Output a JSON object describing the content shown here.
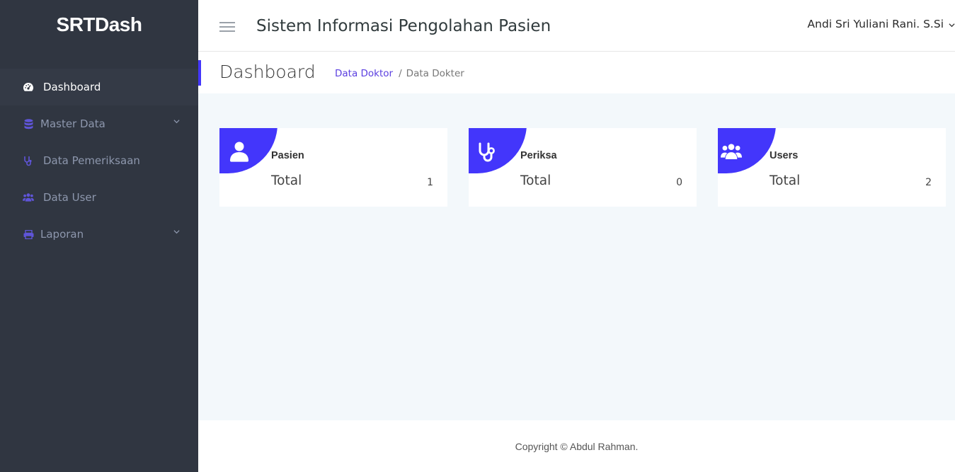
{
  "sidebar": {
    "logo": "SRTDash",
    "items": [
      {
        "label": "Dashboard",
        "icon": "dashboard-icon",
        "active": true
      },
      {
        "label": "Master Data",
        "icon": "database-icon",
        "has_children": true
      },
      {
        "label": "Data Pemeriksaan",
        "icon": "stethoscope-icon"
      },
      {
        "label": "Data User",
        "icon": "users-icon"
      },
      {
        "label": "Laporan",
        "icon": "printer-icon",
        "has_children": true
      }
    ]
  },
  "header": {
    "title": "Sistem Informasi Pengolahan Pasien",
    "user_name": "Andi Sri Yuliani Rani. S.Si"
  },
  "page": {
    "title": "Dashboard",
    "breadcrumb": {
      "link": "Data Doktor",
      "separator": "/",
      "current": "Data Dokter"
    }
  },
  "cards": [
    {
      "title": "Pasien",
      "total_label": "Total",
      "total_value": "1",
      "icon": "user-icon"
    },
    {
      "title": "Periksa",
      "total_label": "Total",
      "total_value": "0",
      "icon": "stethoscope-icon"
    },
    {
      "title": "Users",
      "total_label": "Total",
      "total_value": "2",
      "icon": "users-icon"
    }
  ],
  "footer": {
    "copyright": "Copyright © Abdul Rahman."
  },
  "colors": {
    "accent": "#4336fb",
    "sidebar_bg": "#303641",
    "content_bg": "#f3f8fb"
  }
}
